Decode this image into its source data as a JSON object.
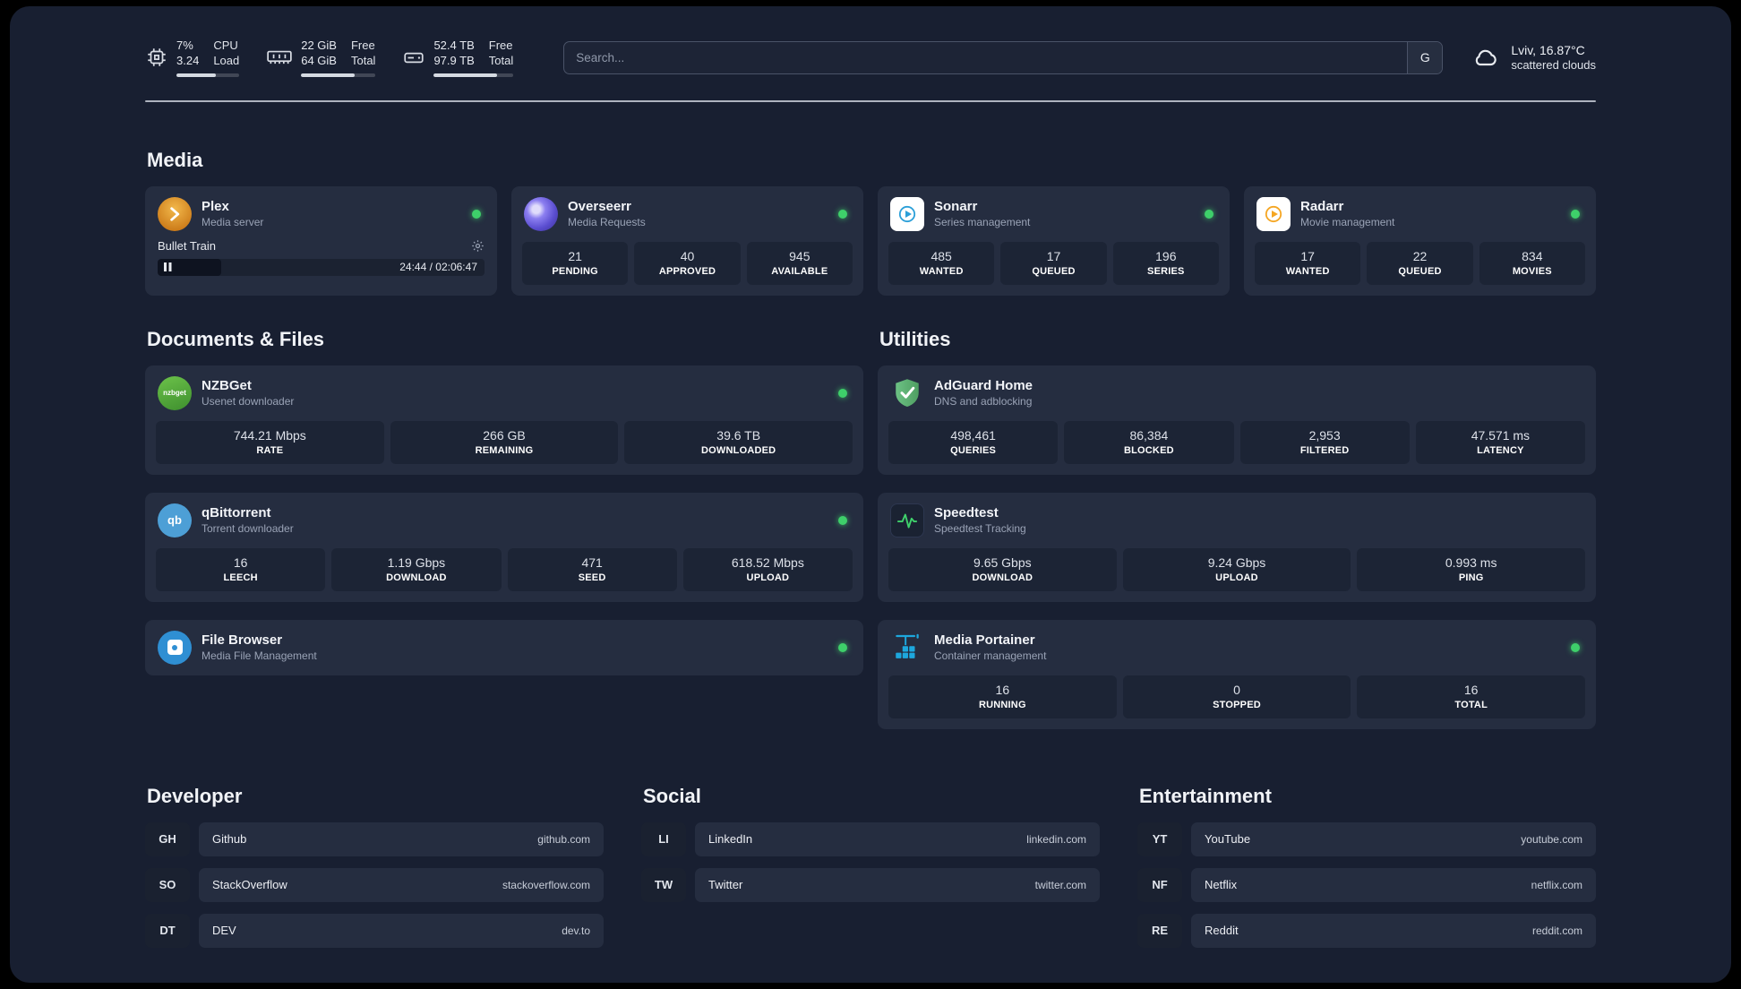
{
  "theme": {
    "page_bg": "#181f31",
    "card_bg": "#252d40",
    "stat_bg": "#1c2435",
    "accent_green": "#3ecf6a"
  },
  "topbar": {
    "cpu": {
      "value_top": "7%",
      "value_bottom": "3.24",
      "label_top": "CPU",
      "label_bottom": "Load",
      "bar_percent": 62
    },
    "ram": {
      "value_top": "22 GiB",
      "value_bottom": "64 GiB",
      "label_top": "Free",
      "label_bottom": "Total",
      "bar_percent": 72
    },
    "disk": {
      "value_top": "52.4 TB",
      "value_bottom": "97.9 TB",
      "label_top": "Free",
      "label_bottom": "Total",
      "bar_percent": 80
    },
    "search": {
      "placeholder": "Search...",
      "engine": "G"
    },
    "weather": {
      "location": "Lviv, 16.87°C",
      "condition": "scattered clouds"
    }
  },
  "media": {
    "title": "Media",
    "cards": [
      {
        "icon": "plex-icon",
        "name": "Plex",
        "subtitle": "Media server",
        "online": true,
        "player": {
          "track": "Bullet Train",
          "time": "24:44 / 02:06:47",
          "progress_percent": 19.5
        }
      },
      {
        "icon": "overseerr-icon",
        "name": "Overseerr",
        "subtitle": "Media Requests",
        "online": true,
        "stats": [
          {
            "value": "21",
            "label": "PENDING"
          },
          {
            "value": "40",
            "label": "APPROVED"
          },
          {
            "value": "945",
            "label": "AVAILABLE"
          }
        ]
      },
      {
        "icon": "sonarr-icon",
        "name": "Sonarr",
        "subtitle": "Series management",
        "online": true,
        "stats": [
          {
            "value": "485",
            "label": "WANTED"
          },
          {
            "value": "17",
            "label": "QUEUED"
          },
          {
            "value": "196",
            "label": "SERIES"
          }
        ]
      },
      {
        "icon": "radarr-icon",
        "name": "Radarr",
        "subtitle": "Movie management",
        "online": true,
        "stats": [
          {
            "value": "17",
            "label": "WANTED"
          },
          {
            "value": "22",
            "label": "QUEUED"
          },
          {
            "value": "834",
            "label": "MOVIES"
          }
        ]
      }
    ]
  },
  "documents": {
    "title": "Documents & Files",
    "cards": [
      {
        "icon": "nzbget-icon",
        "name": "NZBGet",
        "subtitle": "Usenet downloader",
        "online": true,
        "stats": [
          {
            "value": "744.21 Mbps",
            "label": "RATE"
          },
          {
            "value": "266 GB",
            "label": "REMAINING"
          },
          {
            "value": "39.6 TB",
            "label": "DOWNLOADED"
          }
        ]
      },
      {
        "icon": "qbittorrent-icon",
        "name": "qBittorrent",
        "subtitle": "Torrent downloader",
        "online": true,
        "stats": [
          {
            "value": "16",
            "label": "LEECH"
          },
          {
            "value": "1.19 Gbps",
            "label": "DOWNLOAD"
          },
          {
            "value": "471",
            "label": "SEED"
          },
          {
            "value": "618.52 Mbps",
            "label": "UPLOAD"
          }
        ]
      },
      {
        "icon": "filebrowser-icon",
        "name": "File Browser",
        "subtitle": "Media File Management",
        "online": true
      }
    ]
  },
  "utilities": {
    "title": "Utilities",
    "cards": [
      {
        "icon": "adguard-icon",
        "name": "AdGuard Home",
        "subtitle": "DNS and adblocking",
        "online": false,
        "stats": [
          {
            "value": "498,461",
            "label": "QUERIES"
          },
          {
            "value": "86,384",
            "label": "BLOCKED"
          },
          {
            "value": "2,953",
            "label": "FILTERED"
          },
          {
            "value": "47.571 ms",
            "label": "LATENCY"
          }
        ]
      },
      {
        "icon": "speedtest-icon",
        "name": "Speedtest",
        "subtitle": "Speedtest Tracking",
        "online": false,
        "stats": [
          {
            "value": "9.65 Gbps",
            "label": "DOWNLOAD"
          },
          {
            "value": "9.24 Gbps",
            "label": "UPLOAD"
          },
          {
            "value": "0.993 ms",
            "label": "PING"
          }
        ]
      },
      {
        "icon": "portainer-icon",
        "name": "Media Portainer",
        "subtitle": "Container management",
        "online": true,
        "stats": [
          {
            "value": "16",
            "label": "RUNNING"
          },
          {
            "value": "0",
            "label": "STOPPED"
          },
          {
            "value": "16",
            "label": "TOTAL"
          }
        ]
      }
    ]
  },
  "bookmarks": [
    {
      "title": "Developer",
      "items": [
        {
          "abbr": "GH",
          "name": "Github",
          "url": "github.com"
        },
        {
          "abbr": "SO",
          "name": "StackOverflow",
          "url": "stackoverflow.com"
        },
        {
          "abbr": "DT",
          "name": "DEV",
          "url": "dev.to"
        }
      ]
    },
    {
      "title": "Social",
      "items": [
        {
          "abbr": "LI",
          "name": "LinkedIn",
          "url": "linkedin.com"
        },
        {
          "abbr": "TW",
          "name": "Twitter",
          "url": "twitter.com"
        }
      ]
    },
    {
      "title": "Entertainment",
      "items": [
        {
          "abbr": "YT",
          "name": "YouTube",
          "url": "youtube.com"
        },
        {
          "abbr": "NF",
          "name": "Netflix",
          "url": "netflix.com"
        },
        {
          "abbr": "RE",
          "name": "Reddit",
          "url": "reddit.com"
        }
      ]
    }
  ]
}
